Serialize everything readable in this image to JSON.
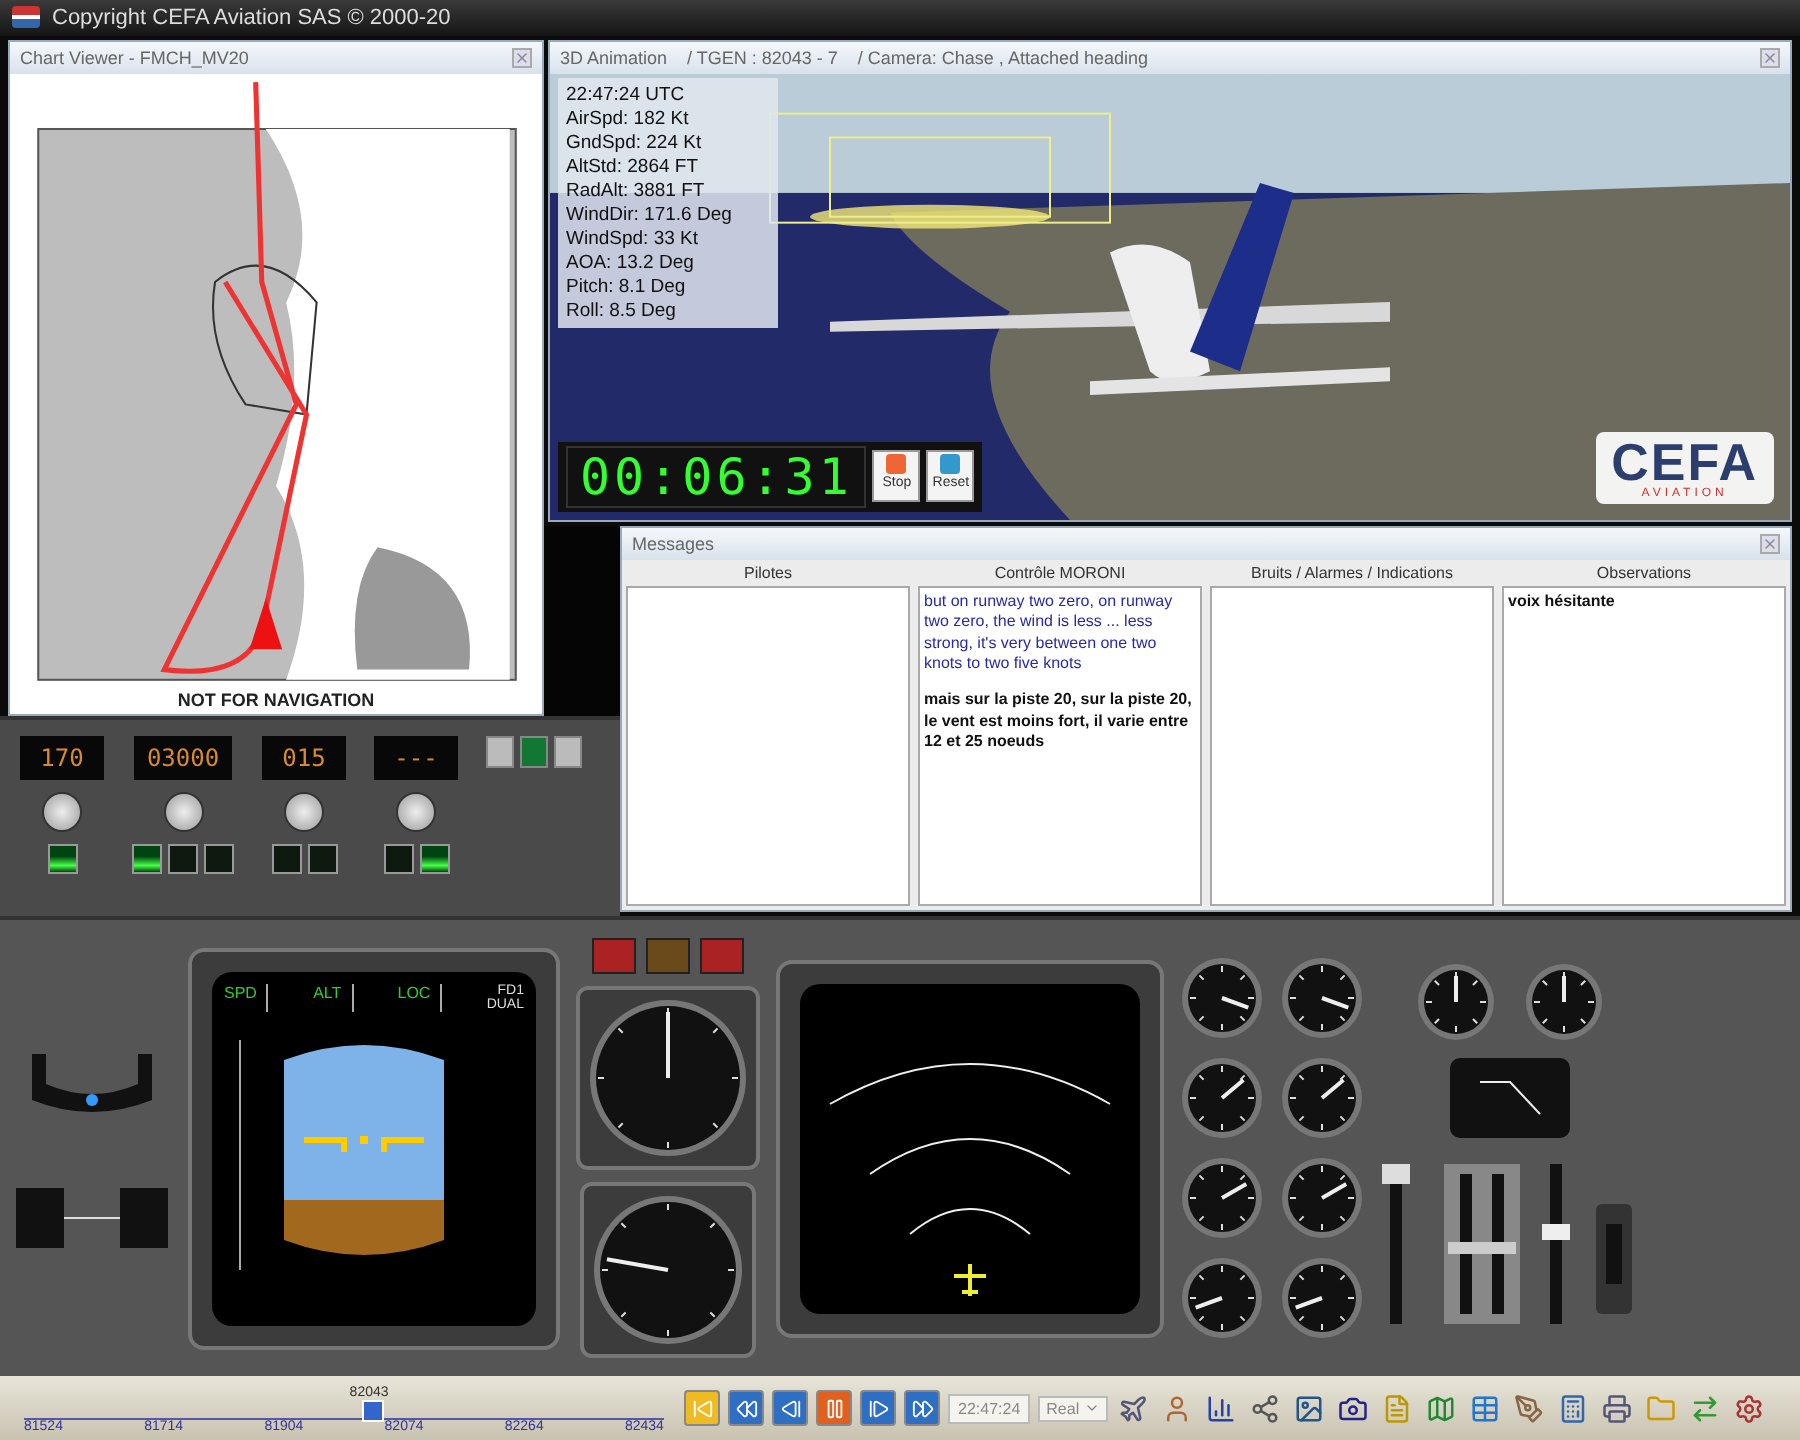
{
  "window": {
    "title": "Copyright CEFA Aviation SAS © 2000-20"
  },
  "chart_viewer": {
    "title": "Chart Viewer - FMCH_MV20",
    "footer": "NOT FOR NAVIGATION"
  },
  "animation": {
    "title": "3D Animation",
    "tgen": "/ TGEN : 82043 - 7",
    "camera": "/ Camera: Chase , Attached heading",
    "telemetry": [
      "22:47:24 UTC",
      "AirSpd: 182 Kt",
      "GndSpd: 224 Kt",
      "AltStd: 2864 FT",
      "RadAlt: 3881 FT",
      "WindDir: 171.6 Deg",
      "WindSpd: 33 Kt",
      "AOA: 13.2 Deg",
      "Pitch: 8.1 Deg",
      "Roll: 8.5 Deg"
    ],
    "timer": "00:06:31",
    "buttons": [
      {
        "label": "Stop",
        "kind": "stop"
      },
      {
        "label": "Reset",
        "kind": "reset"
      }
    ],
    "logo": {
      "name": "CEFA",
      "tagline": "AVIATION"
    }
  },
  "messages": {
    "title": "Messages",
    "columns": [
      {
        "header": "Pilotes"
      },
      {
        "header": "Contrôle MORONI",
        "entries": [
          {
            "kind": "transcript",
            "text": "but on runway two zero, on runway two zero, the wind is less ... less strong, it's very between one two knots to two five knots"
          },
          {
            "kind": "translation",
            "text": "mais sur la piste 20, sur la piste 20, le vent est moins fort, il varie entre 12 et 25 noeuds"
          }
        ]
      },
      {
        "header": "Bruits / Alarmes / Indications"
      },
      {
        "header": "Observations",
        "entries": [
          {
            "kind": "note",
            "text": "voix hésitante"
          }
        ]
      }
    ]
  },
  "autopilot": {
    "displays": [
      {
        "value": "170",
        "lights": [
          {
            "on": true
          }
        ]
      },
      {
        "value": "03000",
        "lights": [
          {
            "on": true
          },
          {
            "on": false
          },
          {
            "on": false
          }
        ]
      },
      {
        "value": "015",
        "lights": [
          {
            "on": false
          },
          {
            "on": false
          }
        ]
      },
      {
        "value": "---",
        "lights": [
          {
            "on": false
          },
          {
            "on": true
          }
        ]
      }
    ],
    "switches": [
      {
        "on": false
      },
      {
        "on": true
      },
      {
        "on": false
      }
    ]
  },
  "pfd": {
    "modes": [
      "SPD",
      "ALT",
      "LOC"
    ],
    "fd": "FD1",
    "fd_mode": "DUAL"
  },
  "timeline": {
    "ticks": [
      "81524",
      "81714",
      "81904",
      "82074",
      "82264",
      "82434"
    ],
    "current": "82043",
    "level": 0.54,
    "time": "22:47:24",
    "speed": "Real"
  }
}
